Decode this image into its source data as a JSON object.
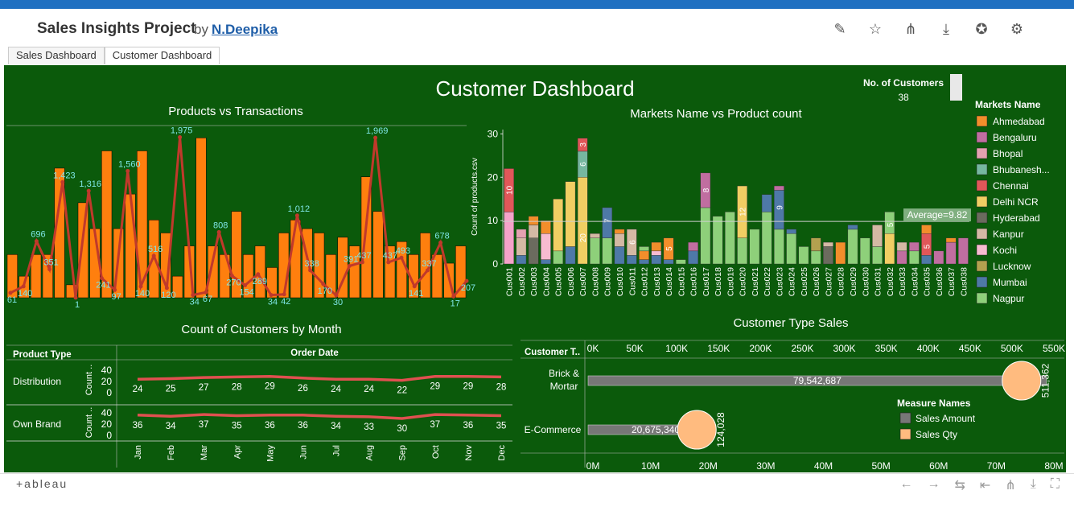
{
  "header": {
    "title": "Sales Insights Project",
    "by": "by",
    "author": "N.Deepika"
  },
  "toolbar_icons": [
    "edit-icon",
    "star-icon",
    "share-icon",
    "download-icon",
    "badge-icon",
    "gear-icon"
  ],
  "tabs": [
    {
      "label": "Sales Dashboard"
    },
    {
      "label": "Customer Dashboard"
    }
  ],
  "dashboard": {
    "title": "Customer Dashboard",
    "kpi": {
      "label": "No. of Customers",
      "value": "38"
    }
  },
  "colors": {
    "bg": "#0b5a0b",
    "bar": "#ff7f0e",
    "line": "#c0392b",
    "label": "#7fe6e6"
  },
  "chart_data": [
    {
      "type": "bar+line",
      "title": "Products vs Transactions",
      "bars": [
        1,
        0.5,
        1,
        1,
        3,
        0.3,
        2.2,
        1.6,
        3.4,
        1.6,
        2.4,
        3.4,
        1.8,
        1.5,
        0.5,
        1.2,
        3.7,
        1.2,
        1,
        2,
        1,
        1.2,
        0.7,
        1.5,
        1.8,
        1.6,
        1.5,
        1,
        1.4,
        1.2,
        2.8,
        2,
        1.2,
        1.3,
        1,
        1.5,
        1,
        0.8,
        1.2
      ],
      "line": [
        61,
        140,
        696,
        351,
        1423,
        1,
        1316,
        241,
        97,
        1560,
        140,
        516,
        120,
        1975,
        34,
        67,
        808,
        270,
        154,
        289,
        34,
        42,
        1012,
        338,
        170,
        30,
        391,
        437,
        1969,
        437,
        493,
        141,
        337,
        678,
        17,
        207
      ],
      "labels": [
        "61",
        "140",
        "696",
        "351",
        "1,423",
        "1",
        "1,316",
        "241",
        "97",
        "1,560",
        "140",
        "516",
        "120",
        "1,975",
        "34",
        "67",
        "808",
        "270",
        "154",
        "289",
        "34",
        "42",
        "1,012",
        "338",
        "170",
        "30",
        "391",
        "437",
        "1,969",
        "437",
        "493",
        "141",
        "337",
        "678",
        "17",
        "207"
      ]
    },
    {
      "type": "bar",
      "title": "Markets Name vs Product count",
      "ylabel": "Count of products.csv",
      "yticks": [
        "0",
        "10",
        "20",
        "30"
      ],
      "average_label": "Average=9.82",
      "average": 9.82,
      "categories": [
        "Cus001",
        "Cus002",
        "Cus003",
        "Cus004",
        "Cus005",
        "Cus006",
        "Cus007",
        "Cus008",
        "Cus009",
        "Cus010",
        "Cus011",
        "Cus012",
        "Cus013",
        "Cus014",
        "Cus015",
        "Cus016",
        "Cus017",
        "Cus018",
        "Cus019",
        "Cus020",
        "Cus021",
        "Cus022",
        "Cus023",
        "Cus024",
        "Cus025",
        "Cus026",
        "Cus027",
        "Cus028",
        "Cus029",
        "Cus030",
        "Cus031",
        "Cus032",
        "Cus033",
        "Cus034",
        "Cus035",
        "Cus036",
        "Cus037",
        "Cus038"
      ],
      "stacks": [
        [
          [
            12,
            "#f4a3c9"
          ],
          [
            10,
            "#e15759"
          ]
        ],
        [
          [
            2,
            "#4e79a7"
          ],
          [
            4,
            "#d4b9a4"
          ],
          [
            2,
            "#e3a1b0"
          ]
        ],
        [
          [
            6,
            "#6b6b5e"
          ],
          [
            3,
            "#d4b9a4"
          ],
          [
            2,
            "#f28e2b"
          ]
        ],
        [
          [
            1,
            "#4e79a7"
          ],
          [
            6,
            "#f8bbd0"
          ],
          [
            3,
            "#f28e2b"
          ]
        ],
        [
          [
            3,
            "#8ed07a"
          ],
          [
            12,
            "#f1ce63"
          ]
        ],
        [
          [
            4,
            "#4e79a7"
          ],
          [
            15,
            "#f1ce63"
          ]
        ],
        [
          [
            20,
            "#f1ce63"
          ],
          [
            6,
            "#76b7a0"
          ],
          [
            3,
            "#e15759"
          ]
        ],
        [
          [
            6,
            "#8ed07a"
          ],
          [
            1,
            "#d4b9a4"
          ]
        ],
        [
          [
            6,
            "#8ed07a"
          ],
          [
            7,
            "#4e79a7"
          ]
        ],
        [
          [
            4,
            "#4e79a7"
          ],
          [
            3,
            "#d4b9a4"
          ],
          [
            1,
            "#f28e2b"
          ]
        ],
        [
          [
            2,
            "#4e79a7"
          ],
          [
            6,
            "#d4b9a4"
          ]
        ],
        [
          [
            1,
            "#4e79a7"
          ],
          [
            2,
            "#f28e2b"
          ],
          [
            1,
            "#8ed07a"
          ]
        ],
        [
          [
            2,
            "#4e79a7"
          ],
          [
            1,
            "#f8bbd0"
          ],
          [
            2,
            "#f28e2b"
          ]
        ],
        [
          [
            1,
            "#4e79a7"
          ],
          [
            5,
            "#f28e2b"
          ]
        ],
        [
          [
            1,
            "#8ed07a"
          ]
        ],
        [
          [
            3,
            "#4e79a7"
          ],
          [
            2,
            "#c06ea0"
          ]
        ],
        [
          [
            13,
            "#8ed07a"
          ],
          [
            8,
            "#c06ea0"
          ]
        ],
        [
          [
            11,
            "#8ed07a"
          ]
        ],
        [
          [
            12,
            "#8ed07a"
          ]
        ],
        [
          [
            6,
            "#8ed07a"
          ],
          [
            12,
            "#f1ce63"
          ]
        ],
        [
          [
            8,
            "#8ed07a"
          ]
        ],
        [
          [
            12,
            "#8ed07a"
          ],
          [
            4,
            "#4e79a7"
          ]
        ],
        [
          [
            8,
            "#8ed07a"
          ],
          [
            9,
            "#4e79a7"
          ],
          [
            1,
            "#c06ea0"
          ]
        ],
        [
          [
            7,
            "#8ed07a"
          ],
          [
            1,
            "#4e79a7"
          ]
        ],
        [
          [
            4,
            "#8ed07a"
          ]
        ],
        [
          [
            3,
            "#8ed07a"
          ],
          [
            3,
            "#b3a14f"
          ]
        ],
        [
          [
            4,
            "#6b6b5e"
          ],
          [
            1,
            "#d4b9a4"
          ]
        ],
        [
          [
            5,
            "#f28e2b"
          ]
        ],
        [
          [
            8,
            "#8ed07a"
          ],
          [
            1,
            "#4e79a7"
          ]
        ],
        [
          [
            6,
            "#8ed07a"
          ]
        ],
        [
          [
            4,
            "#8ed07a"
          ],
          [
            5,
            "#d4b9a4"
          ]
        ],
        [
          [
            7,
            "#f1ce63"
          ],
          [
            5,
            "#8ed07a"
          ]
        ],
        [
          [
            3,
            "#c06ea0"
          ],
          [
            2,
            "#d4b9a4"
          ]
        ],
        [
          [
            3,
            "#8ed07a"
          ],
          [
            2,
            "#c06ea0"
          ]
        ],
        [
          [
            2,
            "#4e79a7"
          ],
          [
            5,
            "#e15759"
          ],
          [
            2,
            "#f28e2b"
          ]
        ],
        [
          [
            3,
            "#c06ea0"
          ]
        ],
        [
          [
            5,
            "#c06ea0"
          ],
          [
            1,
            "#f28e2b"
          ]
        ],
        [
          [
            6,
            "#c06ea0"
          ]
        ]
      ],
      "segment_labels": [
        {
          "i": 0,
          "text": "10",
          "v": 17
        },
        {
          "i": 6,
          "text": "20",
          "v": 6
        },
        {
          "i": 6,
          "text": "6",
          "v": 23
        },
        {
          "i": 6,
          "text": "3",
          "v": 27.5
        },
        {
          "i": 8,
          "text": "7",
          "v": 10
        },
        {
          "i": 10,
          "text": "6",
          "v": 5
        },
        {
          "i": 13,
          "text": "5",
          "v": 3.5
        },
        {
          "i": 16,
          "text": "8",
          "v": 17
        },
        {
          "i": 19,
          "text": "12",
          "v": 12
        },
        {
          "i": 22,
          "text": "9",
          "v": 13
        },
        {
          "i": 31,
          "text": "5",
          "v": 9
        },
        {
          "i": 34,
          "text": "5",
          "v": 4
        }
      ]
    },
    {
      "type": "line",
      "title": "Count of Customers by Month",
      "row_header": "Product Type",
      "col_header": "Order Date",
      "ylabel": "Count ..",
      "yticks": [
        "0",
        "20",
        "40"
      ],
      "months": [
        "Jan",
        "Feb",
        "Mar",
        "Apr",
        "May",
        "Jun",
        "Jul",
        "Aug",
        "Sep",
        "Oct",
        "Nov",
        "Dec"
      ],
      "series": [
        {
          "name": "Distribution",
          "values": [
            24,
            25,
            27,
            28,
            29,
            26,
            24,
            24,
            22,
            29,
            29,
            28
          ]
        },
        {
          "name": "Own Brand",
          "values": [
            36,
            34,
            37,
            35,
            36,
            36,
            34,
            33,
            30,
            37,
            36,
            35
          ]
        }
      ]
    },
    {
      "type": "bar+bubble",
      "title": "Customer Type Sales",
      "row_header": "Customer T..",
      "categories": [
        "Brick & Mortar",
        "E-Commerce"
      ],
      "sales_amount": [
        79542687,
        20675340
      ],
      "sales_amount_labels": [
        "79,542,687",
        "20,675,340"
      ],
      "sales_qty": [
        511362,
        124028
      ],
      "sales_qty_labels": [
        "511,362",
        "124,028"
      ],
      "top_axis": [
        "0K",
        "50K",
        "100K",
        "150K",
        "200K",
        "250K",
        "300K",
        "350K",
        "400K",
        "450K",
        "500K",
        "550K"
      ],
      "bottom_axis": [
        "0M",
        "10M",
        "20M",
        "30M",
        "40M",
        "50M",
        "60M",
        "70M",
        "80M"
      ],
      "legend_title": "Measure Names",
      "legend": [
        {
          "name": "Sales Amount",
          "color": "#777777"
        },
        {
          "name": "Sales Qty",
          "color": "#ffbb7f"
        }
      ]
    }
  ],
  "market_legend": {
    "title": "Markets Name",
    "items": [
      {
        "name": "Ahmedabad",
        "color": "#f28e2b"
      },
      {
        "name": "Bengaluru",
        "color": "#c06ea0"
      },
      {
        "name": "Bhopal",
        "color": "#e3a1b0"
      },
      {
        "name": "Bhubanesh...",
        "color": "#76b7a0"
      },
      {
        "name": "Chennai",
        "color": "#e15759"
      },
      {
        "name": "Delhi NCR",
        "color": "#f1ce63"
      },
      {
        "name": "Hyderabad",
        "color": "#6b6b5e"
      },
      {
        "name": "Kanpur",
        "color": "#d4b9a4"
      },
      {
        "name": "Kochi",
        "color": "#f8bbd0"
      },
      {
        "name": "Lucknow",
        "color": "#b3a14f"
      },
      {
        "name": "Mumbai",
        "color": "#4e79a7"
      },
      {
        "name": "Nagpur",
        "color": "#8ed07a"
      }
    ]
  },
  "footer": {
    "logo": "+ableau"
  }
}
